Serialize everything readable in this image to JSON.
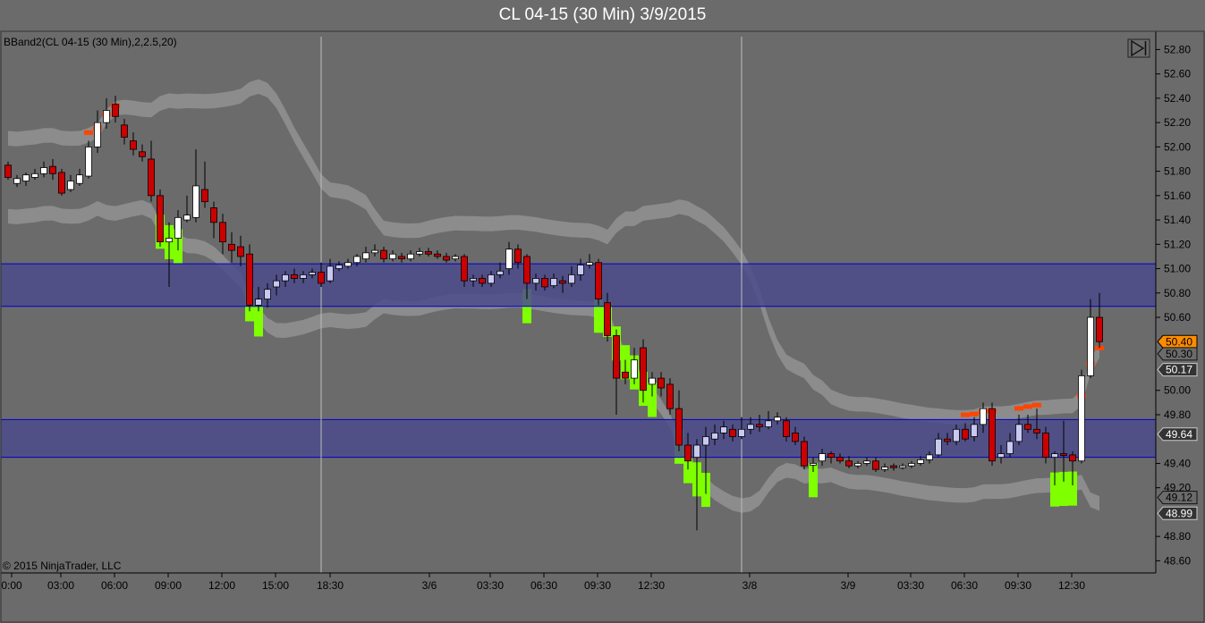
{
  "window": {
    "title": "CL 04-15 (30 Min)  3/9/2015"
  },
  "indicator_label": "BBand2(CL 04-15 (30 Min),2,2.5,20)",
  "copyright": "© 2015 NinjaTrader, LLC",
  "colors": {
    "background": "#6b6b6b",
    "up_candle": "#ffffff",
    "down_candle": "#cc0000",
    "in_zone_up_candle": "#c8c8f0",
    "band": "#909090",
    "band_signal_up": "#7fff00",
    "band_signal_down": "#ff4500",
    "zone_fill": "#4b4b8c",
    "zone_line": "#0000cc",
    "tag_last": "#ff8c00"
  },
  "chart_data": {
    "type": "candlestick",
    "symbol": "CL 04-15",
    "interval": "30 Min",
    "ylim": [
      48.5,
      52.95
    ],
    "yticks": [
      "52.80",
      "52.60",
      "52.40",
      "52.20",
      "52.00",
      "51.80",
      "51.60",
      "51.40",
      "51.20",
      "51.00",
      "50.80",
      "50.60",
      "50.00",
      "49.80",
      "49.40",
      "49.20",
      "48.80",
      "48.60"
    ],
    "xticks": [
      "0:00",
      "03:00",
      "06:00",
      "09:00",
      "12:00",
      "15:00",
      "18:30",
      "3/6",
      "03:30",
      "06:30",
      "09:30",
      "12:30",
      "3/8",
      "3/9",
      "03:30",
      "06:30",
      "09:30",
      "12:30"
    ],
    "session_breaks": [
      "18:30",
      "3/8"
    ],
    "zones": [
      {
        "low": 50.69,
        "high": 51.04
      },
      {
        "low": 49.45,
        "high": 49.76
      }
    ],
    "price_tags": [
      {
        "value": "50.40",
        "style": "last"
      },
      {
        "value": "50.30",
        "style": "plain"
      },
      {
        "value": "50.17",
        "style": "dark"
      },
      {
        "value": "49.64",
        "style": "dark"
      },
      {
        "value": "49.12",
        "style": "plain"
      },
      {
        "value": "48.99",
        "style": "dark"
      }
    ],
    "candles": [
      [
        51.85,
        51.75,
        51.88,
        51.73
      ],
      [
        51.7,
        51.74,
        51.77,
        51.67
      ],
      [
        51.72,
        51.77,
        51.79,
        51.68
      ],
      [
        51.75,
        51.78,
        51.82,
        51.73
      ],
      [
        51.78,
        51.83,
        51.88,
        51.75
      ],
      [
        51.84,
        51.78,
        51.9,
        51.73
      ],
      [
        51.79,
        51.62,
        51.82,
        51.6
      ],
      [
        51.65,
        51.72,
        51.77,
        51.63
      ],
      [
        51.7,
        51.77,
        51.82,
        51.68
      ],
      [
        51.76,
        52.0,
        52.05,
        51.74
      ],
      [
        52.0,
        52.2,
        52.3,
        51.95
      ],
      [
        52.2,
        52.3,
        52.4,
        52.15
      ],
      [
        52.35,
        52.25,
        52.42,
        52.2
      ],
      [
        52.18,
        52.08,
        52.23,
        52.02
      ],
      [
        52.05,
        51.98,
        52.12,
        51.93
      ],
      [
        51.96,
        51.92,
        52.02,
        51.88
      ],
      [
        51.9,
        51.6,
        52.05,
        51.55
      ],
      [
        51.6,
        51.22,
        51.65,
        51.18
      ],
      [
        51.22,
        51.25,
        51.38,
        50.85
      ],
      [
        51.25,
        51.42,
        51.48,
        51.15
      ],
      [
        51.4,
        51.44,
        51.6,
        51.38
      ],
      [
        51.42,
        51.68,
        51.98,
        51.38
      ],
      [
        51.65,
        51.55,
        51.88,
        51.5
      ],
      [
        51.5,
        51.38,
        51.55,
        51.25
      ],
      [
        51.38,
        51.22,
        51.45,
        51.12
      ],
      [
        51.2,
        51.15,
        51.3,
        51.05
      ],
      [
        51.18,
        51.1,
        51.27,
        51.02
      ],
      [
        51.12,
        50.7,
        51.2,
        50.65
      ],
      [
        50.7,
        50.75,
        50.85,
        50.65
      ],
      [
        50.75,
        50.83,
        50.88,
        50.68
      ],
      [
        50.85,
        50.9,
        50.95,
        50.78
      ],
      [
        50.9,
        50.95,
        50.98,
        50.85
      ],
      [
        50.95,
        50.92,
        51.0,
        50.88
      ],
      [
        50.92,
        50.95,
        50.98,
        50.88
      ],
      [
        50.95,
        50.97,
        51.0,
        50.92
      ],
      [
        50.97,
        50.88,
        51.05,
        50.85
      ],
      [
        50.9,
        51.02,
        51.08,
        50.88
      ],
      [
        51.0,
        51.03,
        51.06,
        50.98
      ],
      [
        51.02,
        51.05,
        51.08,
        51.0
      ],
      [
        51.05,
        51.1,
        51.12,
        51.02
      ],
      [
        51.08,
        51.13,
        51.18,
        51.05
      ],
      [
        51.13,
        51.15,
        51.2,
        51.1
      ],
      [
        51.15,
        51.08,
        51.18,
        51.05
      ],
      [
        51.08,
        51.12,
        51.15,
        51.06
      ],
      [
        51.1,
        51.08,
        51.13,
        51.05
      ],
      [
        51.08,
        51.12,
        51.15,
        51.06
      ],
      [
        51.12,
        51.14,
        51.17,
        51.1
      ],
      [
        51.14,
        51.12,
        51.17,
        51.1
      ],
      [
        51.12,
        51.1,
        51.15,
        51.08
      ],
      [
        51.1,
        51.07,
        51.13,
        51.05
      ],
      [
        51.08,
        51.1,
        51.12,
        51.06
      ],
      [
        51.1,
        50.9,
        51.12,
        50.85
      ],
      [
        50.9,
        50.92,
        50.95,
        50.85
      ],
      [
        50.92,
        50.88,
        50.95,
        50.85
      ],
      [
        50.88,
        50.95,
        50.98,
        50.85
      ],
      [
        50.95,
        50.98,
        51.05,
        50.92
      ],
      [
        51.0,
        51.16,
        51.22,
        50.95
      ],
      [
        51.16,
        51.05,
        51.2,
        51.0
      ],
      [
        51.1,
        50.88,
        51.12,
        50.75
      ],
      [
        50.88,
        50.92,
        50.96,
        50.82
      ],
      [
        50.92,
        50.85,
        50.95,
        50.82
      ],
      [
        50.86,
        50.92,
        50.96,
        50.84
      ],
      [
        50.9,
        50.88,
        50.94,
        50.8
      ],
      [
        50.88,
        50.95,
        51.02,
        50.85
      ],
      [
        50.95,
        51.03,
        51.08,
        50.9
      ],
      [
        51.03,
        51.05,
        51.12,
        51.0
      ],
      [
        51.05,
        50.75,
        51.08,
        50.7
      ],
      [
        50.72,
        50.45,
        50.8,
        50.4
      ],
      [
        50.45,
        50.1,
        50.5,
        49.8
      ],
      [
        50.15,
        50.1,
        50.25,
        50.05
      ],
      [
        50.1,
        50.25,
        50.35,
        50.05
      ],
      [
        50.35,
        50.0,
        50.42,
        49.9
      ],
      [
        50.05,
        50.1,
        50.15,
        49.95
      ],
      [
        50.1,
        50.02,
        50.15,
        49.95
      ],
      [
        50.05,
        49.85,
        50.1,
        49.8
      ],
      [
        49.85,
        49.55,
        50.0,
        49.5
      ],
      [
        49.55,
        49.42,
        49.65,
        49.35
      ],
      [
        49.45,
        49.55,
        49.6,
        48.85
      ],
      [
        49.55,
        49.62,
        49.7,
        49.15
      ],
      [
        49.6,
        49.65,
        49.72,
        49.55
      ],
      [
        49.65,
        49.7,
        49.75,
        49.6
      ],
      [
        49.68,
        49.62,
        49.72,
        49.58
      ],
      [
        49.62,
        49.68,
        49.78,
        49.6
      ],
      [
        49.68,
        49.72,
        49.78,
        49.64
      ],
      [
        49.72,
        49.7,
        49.8,
        49.66
      ],
      [
        49.7,
        49.75,
        49.83,
        49.68
      ],
      [
        49.75,
        49.78,
        49.82,
        49.72
      ],
      [
        49.75,
        49.62,
        49.78,
        49.58
      ],
      [
        49.65,
        49.58,
        49.7,
        49.55
      ],
      [
        49.58,
        49.38,
        49.62,
        49.35
      ],
      [
        49.4,
        49.4,
        49.45,
        49.33
      ],
      [
        49.42,
        49.48,
        49.52,
        49.38
      ],
      [
        49.48,
        49.45,
        49.5,
        49.4
      ],
      [
        49.45,
        49.42,
        49.48,
        49.4
      ],
      [
        49.42,
        49.38,
        49.46,
        49.36
      ],
      [
        49.38,
        49.4,
        49.42,
        49.36
      ],
      [
        49.4,
        49.42,
        49.45,
        49.38
      ],
      [
        49.42,
        49.35,
        49.45,
        49.33
      ],
      [
        49.35,
        49.37,
        49.4,
        49.33
      ],
      [
        49.38,
        49.37,
        49.4,
        49.34
      ],
      [
        49.37,
        49.38,
        49.4,
        49.35
      ],
      [
        49.38,
        49.4,
        49.42,
        49.36
      ],
      [
        49.4,
        49.43,
        49.46,
        49.38
      ],
      [
        49.43,
        49.47,
        49.5,
        49.4
      ],
      [
        49.47,
        49.6,
        49.65,
        49.45
      ],
      [
        49.6,
        49.58,
        49.65,
        49.55
      ],
      [
        49.58,
        49.68,
        49.72,
        49.55
      ],
      [
        49.68,
        49.6,
        49.73,
        49.58
      ],
      [
        49.62,
        49.72,
        49.78,
        49.58
      ],
      [
        49.72,
        49.85,
        49.9,
        49.65
      ],
      [
        49.85,
        49.42,
        49.9,
        49.38
      ],
      [
        49.45,
        49.48,
        49.55,
        49.4
      ],
      [
        49.48,
        49.58,
        49.65,
        49.45
      ],
      [
        49.58,
        49.72,
        49.8,
        49.55
      ],
      [
        49.72,
        49.68,
        49.8,
        49.65
      ],
      [
        49.68,
        49.65,
        49.85,
        49.6
      ],
      [
        49.65,
        49.45,
        49.7,
        49.4
      ],
      [
        49.45,
        49.48,
        49.5,
        49.22
      ],
      [
        49.48,
        49.47,
        49.75,
        49.25
      ],
      [
        49.47,
        49.42,
        49.5,
        49.22
      ],
      [
        49.42,
        50.12,
        50.17,
        49.4
      ],
      [
        50.12,
        50.6,
        50.75,
        50.1
      ],
      [
        50.6,
        50.4,
        50.8,
        50.35
      ]
    ]
  },
  "controls": {
    "playback_icon": "skip-to-end-icon"
  }
}
